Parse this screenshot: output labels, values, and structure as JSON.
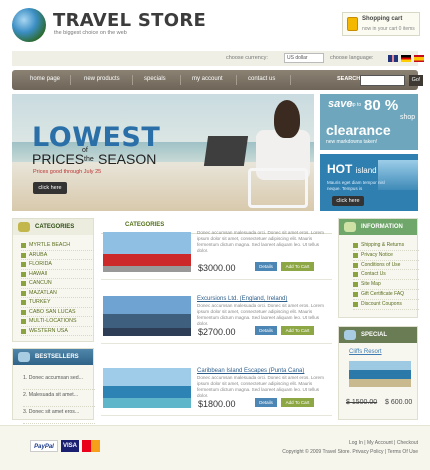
{
  "header": {
    "title": "TRAVEL STORE",
    "tagline": "the biggest choice on the web",
    "cart_title": "Shopping cart",
    "cart_info": "now in your cart 0 items"
  },
  "util": {
    "currency_label": "choose currency:",
    "currency_value": "US dollar",
    "language_label": "choose language:",
    "flags": [
      "uk-flag-icon",
      "germany-flag-icon",
      "spain-flag-icon"
    ]
  },
  "nav": {
    "items": [
      "home page",
      "new products",
      "specials",
      "my account",
      "contact us"
    ],
    "search_label": "SEARCH",
    "search_button": "Go!"
  },
  "hero": {
    "headline": "LOWEST",
    "prices": "PRICES",
    "of": "of",
    "the": "the",
    "season": "SEASON",
    "date": "Prices good through July 25",
    "button": "click here"
  },
  "promo_sale": {
    "save": "save",
    "upto": "up to",
    "percent": "80 %",
    "shop": "shop",
    "clearance": "clearance",
    "markdown": "new markdowns taken!"
  },
  "promo_hot": {
    "hot": "HOT",
    "island": "island",
    "desc": "Mauris eget diam tempor nisl neque. Tempus is",
    "button": "click here"
  },
  "categories": {
    "title": "CATEGORIES",
    "items": [
      "MYRTLE BEACH",
      "ARUBA",
      "FLORIDA",
      "HAWAII",
      "CANCUN",
      "MAZATLAN",
      "TURKEY",
      "CABO SAN LUCAS",
      "MULTI-LOCATIONS",
      "WESTERN USA"
    ]
  },
  "bestsellers": {
    "title": "BESTSELLERS",
    "items": [
      "1. Donec accumsan sed...",
      "2. Malesuada sit amet...",
      "3. Donec sit amet eros..."
    ]
  },
  "center": {
    "title": "CATEGORIES",
    "products": [
      {
        "name": "",
        "desc": "Donec accumsan malesuada orci. Donec sit amet eros. Lorem ipsum dolor sit amet, consectetuer adipiscing elit. Mauris fermentum dictum magna. Sed laoreet aliquam leo. Ut tellus dolor.",
        "price": "$3000.00",
        "details": "Details",
        "cart": "Add To Cart"
      },
      {
        "name": "Excursions Ltd. (England, Ireland)",
        "desc": "Donec accumsan malesuada orci. Donec sit amet eros. Lorem ipsum dolor sit amet, consectetuer adipiscing elit. Mauris fermentum dictum magna. Sed laoreet aliquam leo. Ut tellus dolor.",
        "price": "$2700.00",
        "details": "Details",
        "cart": "Add To Cart"
      },
      {
        "name": "Caribbean Island Escapes (Punta Cana)",
        "desc": "Donec accumsan malesuada orci. Donec sit amet eros. Lorem ipsum dolor sit amet, consectetuer adipiscing elit. Mauris fermentum dictum magna. Sed laoreet aliquam leo. Ut tellus dolor.",
        "price": "$1800.00",
        "details": "Details",
        "cart": "Add To Cart"
      }
    ]
  },
  "information": {
    "title": "INFORMATION",
    "items": [
      "Shipping & Returns",
      "Privacy Notice",
      "Conditions of Use",
      "Contact Us",
      "Site Map",
      "Gift Certificate FAQ",
      "Discount Coupons"
    ]
  },
  "special": {
    "title": "SPECIAL",
    "name": "Cliffs Resort",
    "old_price": "$ 1500.00",
    "new_price": "$ 600.00"
  },
  "footer": {
    "links": "Log In | My Account | Checkout",
    "copy": "Copyright © 2009 Travel Store. Privacy Policy | Terms Of Use",
    "paypal": "PayPal",
    "visa": "VISA",
    "mastercard": "MC"
  },
  "colors": {
    "accent": "#2a6fa8",
    "nav": "#7c7366",
    "green": "#8ea745"
  }
}
